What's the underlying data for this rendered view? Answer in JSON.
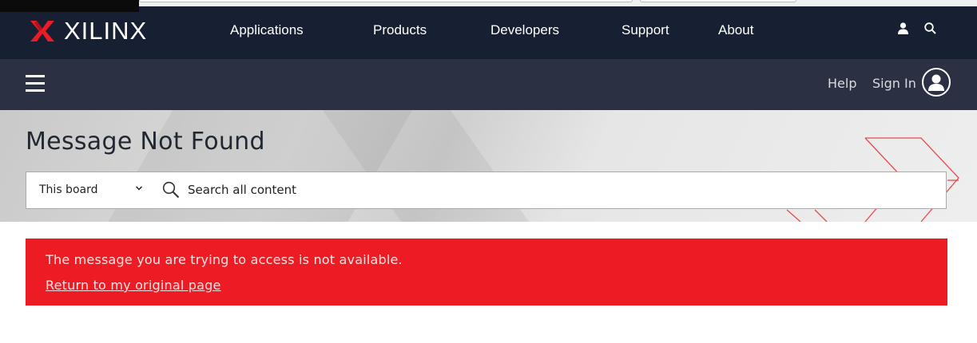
{
  "brand": {
    "name": "XILINX",
    "accent": "#ed1c24"
  },
  "main_nav": {
    "links": [
      "Applications",
      "Products",
      "Developers",
      "Support",
      "About"
    ],
    "icons": [
      "user-icon",
      "search-icon"
    ]
  },
  "sub_nav": {
    "help": "Help",
    "sign_in": "Sign In"
  },
  "hero": {
    "title": "Message Not Found",
    "search": {
      "scope_selected": "This board",
      "placeholder": "Search all content",
      "value": ""
    }
  },
  "alert": {
    "message": "The message you are trying to access is not available.",
    "link": "Return to my original page"
  },
  "colors": {
    "nav_bg": "#162032",
    "subnav_bg": "#2b3143",
    "alert_bg": "#ed1c24"
  }
}
